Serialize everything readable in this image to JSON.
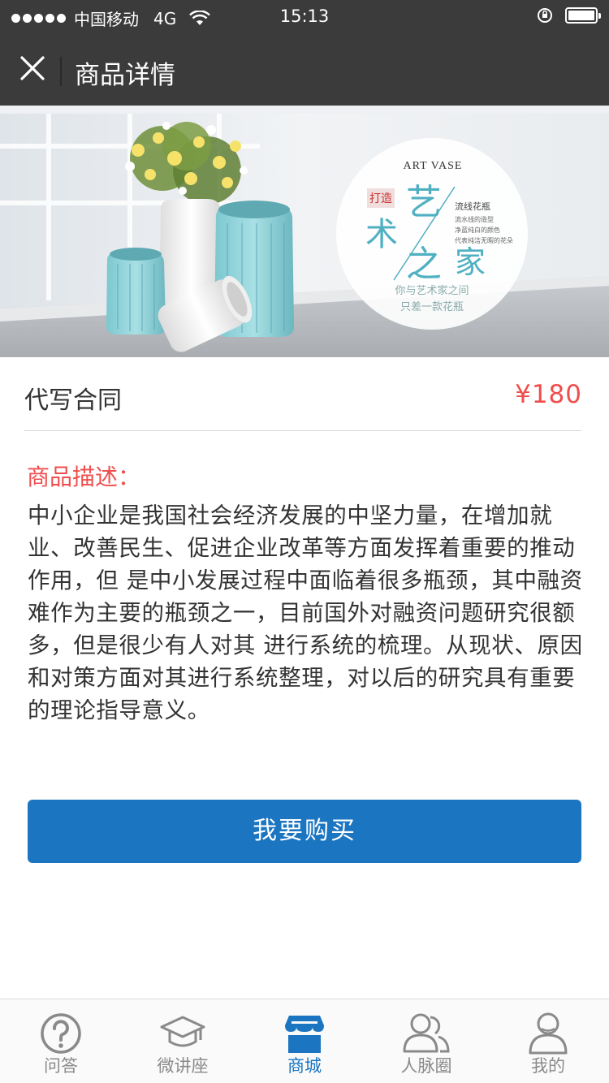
{
  "status_bar": {
    "carrier": "中国移动",
    "network": "4G",
    "time": "15:13"
  },
  "nav": {
    "title": "商品详情",
    "close_icon": "close-icon"
  },
  "banner": {
    "art_title": "ART VASE",
    "badge": "打造",
    "headline_part1": "艺",
    "headline_part2": "术",
    "headline_part3": "之",
    "headline_part4": "家",
    "side_title": "流线花瓶",
    "side_line1": "流水线的造型",
    "side_line2": "净蓝纯白的颜色",
    "side_line3": "代表纯洁无暇的花朵",
    "tagline1": "你与艺术家之间",
    "tagline2": "只差一款花瓶"
  },
  "product": {
    "name": "代写合同",
    "price": "¥180"
  },
  "description": {
    "title": "商品描述：",
    "body": "中小企业是我国社会经济发展的中坚力量，在增加就业、改善民生、促进企业改革等方面发挥着重要的推动作用，但 是中小发展过程中面临着很多瓶颈，其中融资难作为主要的瓶颈之一，目前国外对融资问题研究很额多，但是很少有人对其 进行系统的梳理。从现状、原因和对策方面对其进行系统整理，对以后的研究具有重要的理论指导意义。"
  },
  "actions": {
    "buy_label": "我要购买"
  },
  "colors": {
    "accent": "#1b75c1",
    "price": "#f04d4d",
    "header": "#3b3b3b"
  },
  "tabs": [
    {
      "label": "问答",
      "icon": "question-icon",
      "active": false
    },
    {
      "label": "微讲座",
      "icon": "graduation-cap-icon",
      "active": false
    },
    {
      "label": "商城",
      "icon": "store-icon",
      "active": true
    },
    {
      "label": "人脉圈",
      "icon": "people-icon",
      "active": false
    },
    {
      "label": "我的",
      "icon": "user-icon",
      "active": false
    }
  ]
}
